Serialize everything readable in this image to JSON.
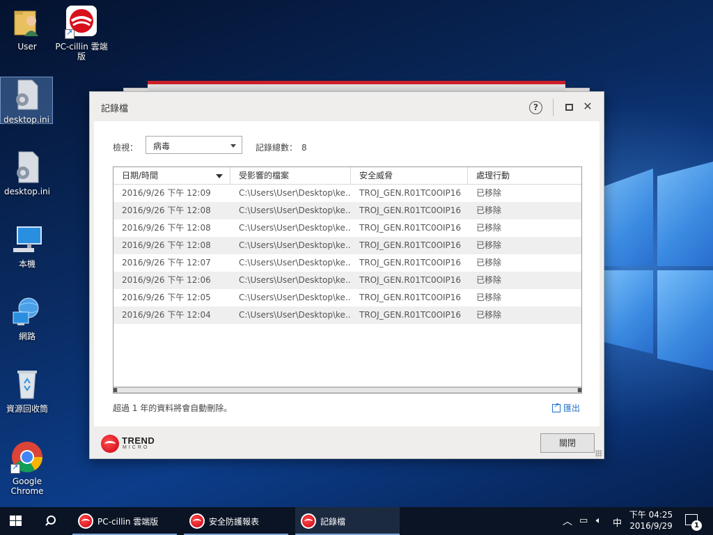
{
  "desktop": {
    "icons": [
      {
        "label": "User"
      },
      {
        "label": "PC-cillin 雲端版"
      },
      {
        "label": "desktop.ini"
      },
      {
        "label": "desktop.ini"
      },
      {
        "label": "本機"
      },
      {
        "label": "網路"
      },
      {
        "label": "資源回收筒"
      },
      {
        "label": "Google Chrome"
      }
    ]
  },
  "dialog": {
    "title": "記錄檔",
    "help_label": "?",
    "close_label": "✕",
    "view_label": "檢視：",
    "view_selected": "病毒",
    "count_label": "記錄總數：",
    "count_value": "8",
    "columns": [
      "日期/時間",
      "受影響的檔案",
      "安全威脅",
      "處理行動"
    ],
    "rows": [
      [
        "2016/9/26 下午 12:09",
        "C:\\Users\\User\\Desktop\\ke...",
        "TROJ_GEN.R01TC0OIP16",
        "已移除"
      ],
      [
        "2016/9/26 下午 12:08",
        "C:\\Users\\User\\Desktop\\ke...",
        "TROJ_GEN.R01TC0OIP16",
        "已移除"
      ],
      [
        "2016/9/26 下午 12:08",
        "C:\\Users\\User\\Desktop\\ke...",
        "TROJ_GEN.R01TC0OIP16",
        "已移除"
      ],
      [
        "2016/9/26 下午 12:08",
        "C:\\Users\\User\\Desktop\\ke...",
        "TROJ_GEN.R01TC0OIP16",
        "已移除"
      ],
      [
        "2016/9/26 下午 12:07",
        "C:\\Users\\User\\Desktop\\ke...",
        "TROJ_GEN.R01TC0OIP16",
        "已移除"
      ],
      [
        "2016/9/26 下午 12:06",
        "C:\\Users\\User\\Desktop\\ke...",
        "TROJ_GEN.R01TC0OIP16",
        "已移除"
      ],
      [
        "2016/9/26 下午 12:05",
        "C:\\Users\\User\\Desktop\\ke...",
        "TROJ_GEN.R01TC0OIP16",
        "已移除"
      ],
      [
        "2016/9/26 下午 12:04",
        "C:\\Users\\User\\Desktop\\ke...",
        "TROJ_GEN.R01TC0OIP16",
        "已移除"
      ]
    ],
    "notice": "超過 1 年的資料將會自動刪除。",
    "export_label": "匯出",
    "close_button": "關閉",
    "logo_line1": "TREND",
    "logo_line2": "MICRO"
  },
  "taskbar": {
    "tasks": [
      {
        "label": "PC-cillin 雲端版"
      },
      {
        "label": "安全防護報表"
      },
      {
        "label": "記錄檔"
      }
    ],
    "ime_label": "中",
    "time": "下午 04:25",
    "date": "2016/9/29",
    "notification_count": "1"
  },
  "colors": {
    "accent_red": "#d0202a",
    "link_blue": "#1a6fc9",
    "taskbar": "#0b1424"
  }
}
